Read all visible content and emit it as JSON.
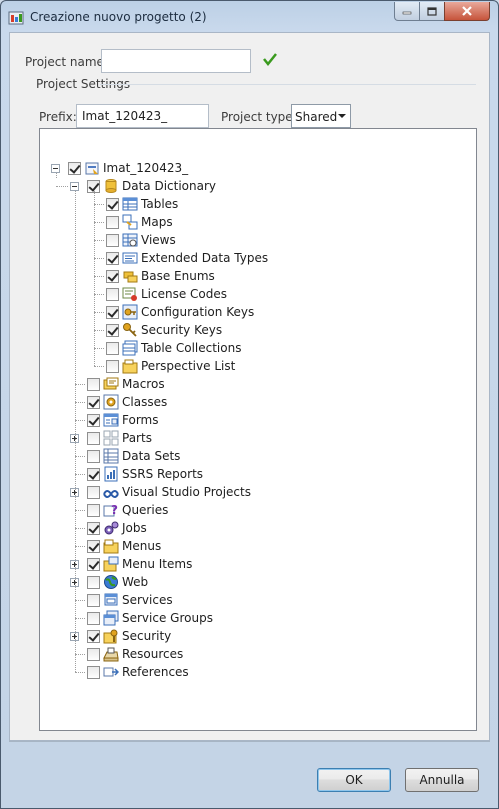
{
  "window": {
    "title": "Creazione nuovo progetto (2)"
  },
  "project_name": {
    "label": "Project name:",
    "value": ""
  },
  "project_settings": {
    "label": "Project Settings",
    "prefix_label": "Prefix:",
    "prefix_value": "Imat_120423_",
    "type_label": "Project type:",
    "type_value": "Shared"
  },
  "tree": {
    "root": {
      "label": "Imat_120423_",
      "checked": true
    },
    "data_dictionary": {
      "label": "Data Dictionary",
      "checked": true
    },
    "dd_items": [
      {
        "label": "Tables",
        "checked": true,
        "icon": "table-icon"
      },
      {
        "label": "Maps",
        "checked": false,
        "icon": "map-icon"
      },
      {
        "label": "Views",
        "checked": false,
        "icon": "view-icon"
      },
      {
        "label": "Extended Data Types",
        "checked": true,
        "icon": "edt-icon"
      },
      {
        "label": "Base Enums",
        "checked": true,
        "icon": "enum-icon"
      },
      {
        "label": "License Codes",
        "checked": false,
        "icon": "license-icon"
      },
      {
        "label": "Configuration Keys",
        "checked": true,
        "icon": "config-key-icon"
      },
      {
        "label": "Security Keys",
        "checked": true,
        "icon": "security-key-icon"
      },
      {
        "label": "Table Collections",
        "checked": false,
        "icon": "table-collection-icon"
      },
      {
        "label": "Perspective List",
        "checked": false,
        "icon": "perspective-icon"
      }
    ],
    "top_items": [
      {
        "label": "Macros",
        "checked": false,
        "expander": false,
        "icon": "macro-icon"
      },
      {
        "label": "Classes",
        "checked": true,
        "expander": false,
        "icon": "class-icon"
      },
      {
        "label": "Forms",
        "checked": true,
        "expander": false,
        "icon": "form-icon"
      },
      {
        "label": "Parts",
        "checked": false,
        "expander": true,
        "icon": "parts-icon"
      },
      {
        "label": "Data Sets",
        "checked": false,
        "expander": false,
        "icon": "dataset-icon"
      },
      {
        "label": "SSRS Reports",
        "checked": true,
        "expander": false,
        "icon": "report-icon"
      },
      {
        "label": "Visual Studio Projects",
        "checked": false,
        "expander": true,
        "icon": "vs-project-icon"
      },
      {
        "label": "Queries",
        "checked": false,
        "expander": false,
        "icon": "query-icon"
      },
      {
        "label": "Jobs",
        "checked": true,
        "expander": false,
        "icon": "job-icon"
      },
      {
        "label": "Menus",
        "checked": true,
        "expander": false,
        "icon": "menu-icon"
      },
      {
        "label": "Menu Items",
        "checked": true,
        "expander": true,
        "icon": "menu-item-icon"
      },
      {
        "label": "Web",
        "checked": false,
        "expander": true,
        "icon": "web-icon"
      },
      {
        "label": "Services",
        "checked": false,
        "expander": false,
        "icon": "service-icon"
      },
      {
        "label": "Service Groups",
        "checked": false,
        "expander": false,
        "icon": "service-group-icon"
      },
      {
        "label": "Security",
        "checked": true,
        "expander": true,
        "icon": "security-icon"
      },
      {
        "label": "Resources",
        "checked": false,
        "expander": false,
        "icon": "resource-icon"
      },
      {
        "label": "References",
        "checked": false,
        "expander": false,
        "icon": "reference-icon"
      }
    ]
  },
  "buttons": {
    "ok": "OK",
    "cancel": "Annulla"
  },
  "colors": {
    "accent": "#3c7fb1",
    "check_green": "#3a9a1e",
    "close_red": "#c6543b"
  }
}
